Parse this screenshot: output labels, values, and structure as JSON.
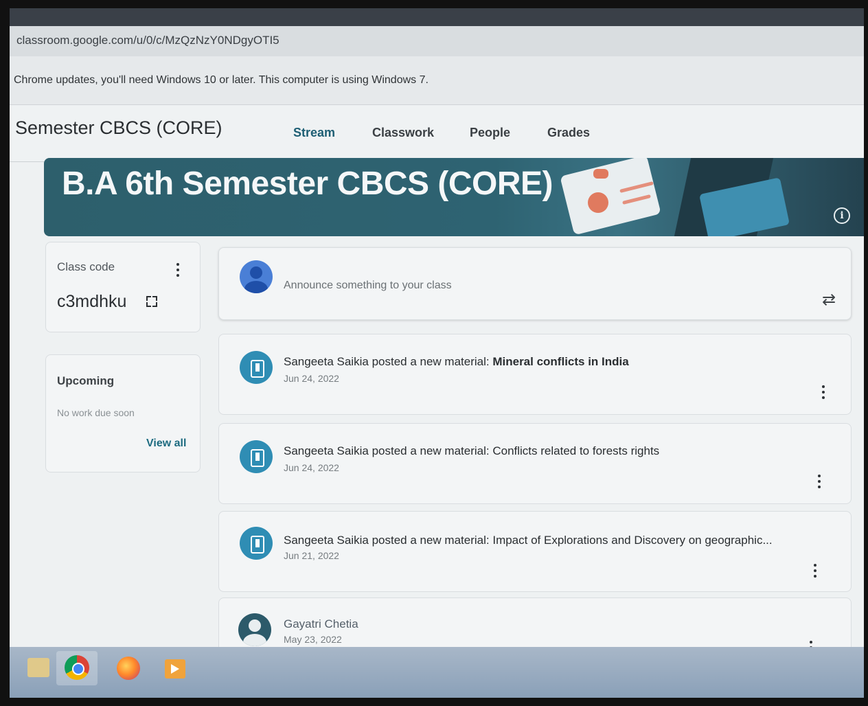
{
  "browser": {
    "url": "classroom.google.com/u/0/c/MzQzNzY0NDgyOTI5",
    "infobar_text": "Chrome updates, you'll need Windows 10 or later. This computer is using Windows 7."
  },
  "header": {
    "class_title": "Semester CBCS (CORE)",
    "tabs": [
      {
        "label": "Stream",
        "active": true
      },
      {
        "label": "Classwork",
        "active": false
      },
      {
        "label": "People",
        "active": false
      },
      {
        "label": "Grades",
        "active": false
      }
    ]
  },
  "banner": {
    "title": "B.A 6th Semester CBCS (CORE)"
  },
  "class_code": {
    "label": "Class code",
    "value": "c3mdhku"
  },
  "upcoming": {
    "title": "Upcoming",
    "text": "No work due soon",
    "link": "View all"
  },
  "announce": {
    "placeholder": "Announce something to your class"
  },
  "posts": [
    {
      "author": "Sangeeta Saikia",
      "action": "posted a new material:",
      "material": "Mineral conflicts in India",
      "date": "Jun 24, 2022",
      "icon": "material-icon"
    },
    {
      "author": "Sangeeta Saikia",
      "action": "posted a new material:",
      "material": "Conflicts related to forests rights",
      "date": "Jun 24, 2022",
      "icon": "material-icon"
    },
    {
      "author": "Sangeeta Saikia",
      "action": "posted a new material:",
      "material": "Impact of Explorations and Discovery on geographic...",
      "date": "Jun 21, 2022",
      "icon": "material-icon"
    },
    {
      "author": "Gayatri Chetia",
      "action": "",
      "material": "",
      "date": "May 23, 2022",
      "icon": "avatar-icon"
    }
  ],
  "colors": {
    "accent": "#1d5e73",
    "banner": "#2d5f6c",
    "material_icon": "#2f8db4",
    "user_avatar": "#4a7fd6"
  },
  "taskbar": {
    "items": [
      "folder-icon",
      "chrome-icon",
      "firefox-icon",
      "media-player-icon"
    ]
  }
}
